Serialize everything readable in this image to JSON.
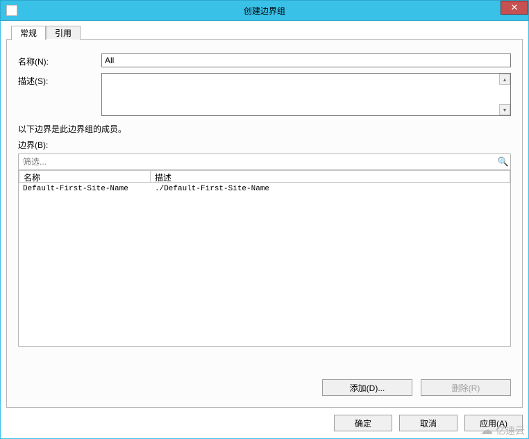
{
  "window": {
    "title": "创建边界组",
    "close_glyph": "✕"
  },
  "tabs": {
    "general": "常规",
    "references": "引用"
  },
  "fields": {
    "name_label": "名称(N):",
    "name_value": "All",
    "desc_label": "描述(S):",
    "desc_value": ""
  },
  "members": {
    "note": "以下边界是此边界组的成员。",
    "label": "边界(B):",
    "filter_placeholder": "筛选...",
    "columns": {
      "name": "名称",
      "desc": "描述"
    },
    "rows": [
      {
        "name": "Default-First-Site-Name",
        "desc": "./Default-First-Site-Name"
      }
    ],
    "add_btn": "添加(D)...",
    "remove_btn": "删除(R)"
  },
  "dialog_buttons": {
    "ok": "确定",
    "cancel": "取消",
    "apply": "应用(A)"
  },
  "watermark": "亿速云"
}
